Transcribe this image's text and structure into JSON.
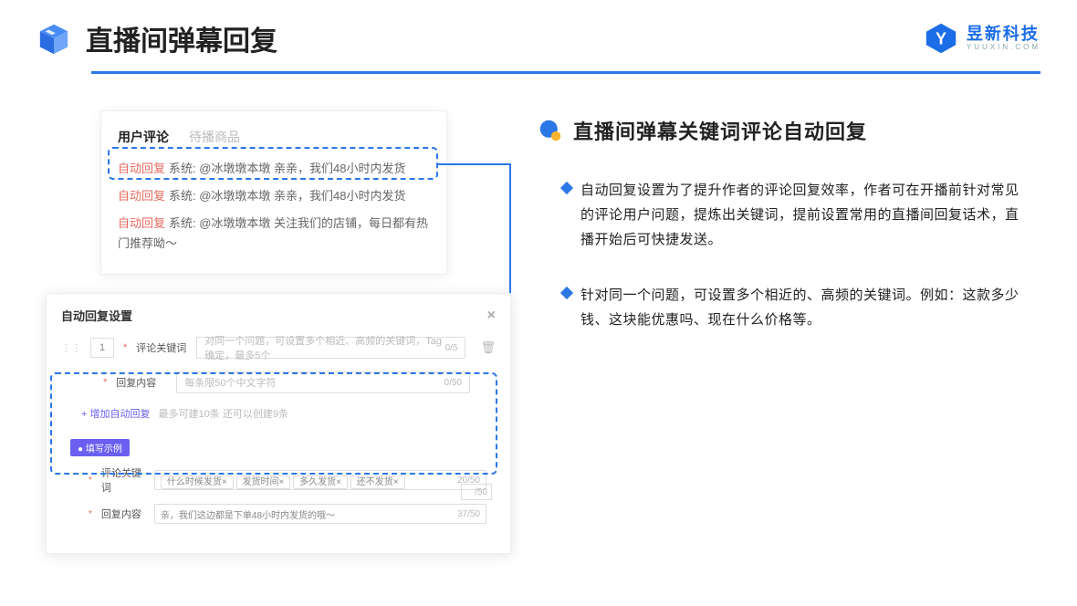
{
  "header": {
    "title": "直播间弹幕回复",
    "brand_cn": "昱新科技",
    "brand_en": "YUUXIN.COM"
  },
  "panel1": {
    "tab_active": "用户评论",
    "tab_inactive": "待播商品",
    "msg1_badge": "自动回复",
    "msg1_text": "系统: @冰墩墩本墩 亲亲，我们48小时内发货",
    "msg2_badge": "自动回复",
    "msg2_text": "系统: @冰墩墩本墩 亲亲，我们48小时内发货",
    "msg3_badge": "自动回复",
    "msg3_text": "系统: @冰墩墩本墩 关注我们的店铺，每日都有热门推荐呦～"
  },
  "panel2": {
    "title": "自动回复设置",
    "num": "1",
    "kw_label": "评论关键词",
    "kw_placeholder": "对同一个问题，可设置多个相近、高频的关键词，Tag确定，最多5个",
    "kw_count": "0/5",
    "content_label": "回复内容",
    "content_placeholder": "每条限50个中文字符",
    "content_count": "0/50",
    "add_label": "+ 增加自动回复",
    "add_hint": "最多可建10条 还可以创建9条",
    "example_badge": "● 填写示例",
    "ex_kw_label": "评论关键词",
    "ex_tags": [
      "什么时候发货×",
      "发货时间×",
      "多久发货×",
      "还不发货×"
    ],
    "ex_kw_count": "20/50",
    "ex_content_label": "回复内容",
    "ex_content_value": "亲，我们这边都是下单48小时内发货的哦～",
    "ex_content_count": "37/50",
    "tail_count": "/50"
  },
  "right": {
    "title": "直播间弹幕关键词评论自动回复",
    "bullet1": "自动回复设置为了提升作者的评论回复效率，作者可在开播前针对常见的评论用户问题，提炼出关键词，提前设置常用的直播间回复话术，直播开始后可快捷发送。",
    "bullet2": "针对同一个问题，可设置多个相近的、高频的关键词。例如：这款多少钱、这块能优惠吗、现在什么价格等。"
  }
}
